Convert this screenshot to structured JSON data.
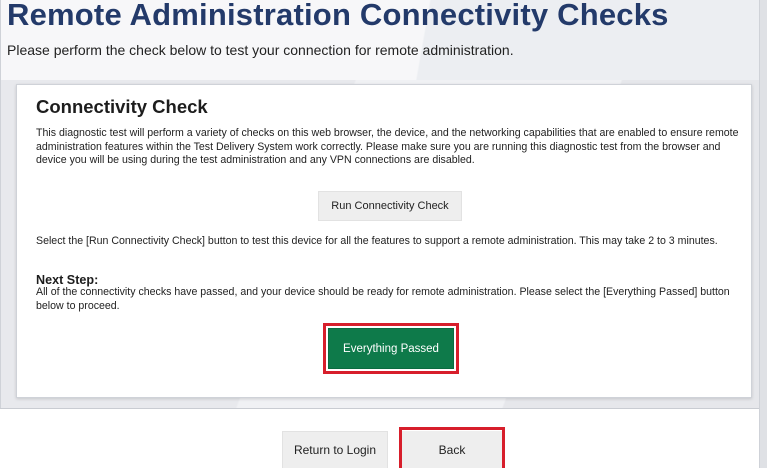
{
  "page": {
    "title": "Remote Administration Connectivity Checks",
    "subtitle": "Please perform the check below to test your connection for remote administration."
  },
  "connectivity_check": {
    "title": "Connectivity Check",
    "description": "This diagnostic test will perform a variety of checks on this web browser, the device, and the networking capabilities that are enabled to ensure remote administration features within the Test Delivery System work correctly. Please make sure you are running this diagnostic test from the browser and device you will be using during the test administration and any VPN connections are disabled.",
    "run_button_label": "Run Connectivity Check",
    "instructions": "Select the [Run Connectivity Check] button to test this device for all the features to support a remote administration. This may take 2 to 3 minutes.",
    "next_step_heading": "Next Step:",
    "next_step_text": "All of the connectivity checks have passed, and your device should be ready for remote administration. Please select the [Everything Passed] button below to proceed.",
    "passed_button_label": "Everything Passed"
  },
  "footer": {
    "return_button_label": "Return to Login",
    "back_button_label": "Back"
  },
  "colors": {
    "title": "#233a6a",
    "passed_button": "#0e7a4a",
    "highlight": "#d71e2b"
  }
}
